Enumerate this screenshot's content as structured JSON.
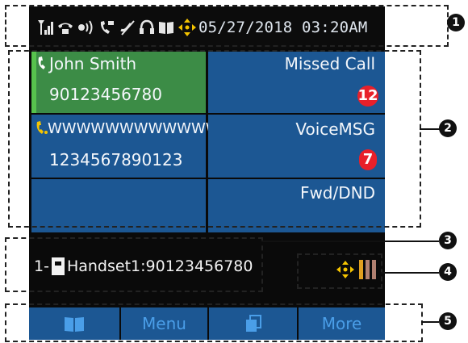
{
  "status_bar": {
    "icons": [
      "signal-antenna-icon",
      "phone-hook-icon",
      "ringer-volume-icon",
      "call-forward-icon",
      "mute-mic-icon",
      "headset-icon",
      "book-icon",
      "navigator-key-icon"
    ],
    "datetime": "05/27/2018 03:20AM"
  },
  "grid": {
    "contact": {
      "name": "John Smith",
      "number": "90123456780"
    },
    "missed_call": {
      "label": "Missed Call",
      "count": "12"
    },
    "line2": {
      "name": "WWWWWWWWWWWW",
      "number": "1234567890123"
    },
    "voice_msg": {
      "label": "VoiceMSG",
      "count": "7"
    },
    "fwd_dnd": {
      "label": "Fwd/DND"
    }
  },
  "handset": {
    "prefix": "1-",
    "label": "Handset1:90123456780"
  },
  "softkeys": {
    "menu": "Menu",
    "more": "More"
  },
  "callouts": [
    "1",
    "2",
    "3",
    "4",
    "5"
  ],
  "colors": {
    "tile_blue": "#1c5793",
    "contact_green": "#3c8c46",
    "badge_red": "#e8202a",
    "nav_yellow": "#f5c400",
    "softkey_text": "#4a9ee8"
  }
}
